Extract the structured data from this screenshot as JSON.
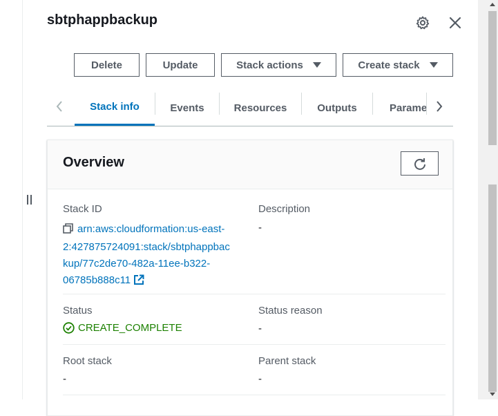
{
  "panel": {
    "title": "sbtphappbackup"
  },
  "actions": {
    "delete": "Delete",
    "update": "Update",
    "stack_actions": "Stack actions",
    "create_stack": "Create stack"
  },
  "tabs": [
    {
      "label": "Stack info",
      "active": true
    },
    {
      "label": "Events"
    },
    {
      "label": "Resources"
    },
    {
      "label": "Outputs"
    },
    {
      "label": "Parameters"
    }
  ],
  "overview": {
    "title": "Overview",
    "stack_id_label": "Stack ID",
    "stack_id_line1": "arn:aws:cloudformation:us-east-",
    "stack_id_line2": "2:427875724091:stack/sbtphappbac",
    "stack_id_line3": "kup/77c2de70-482a-11ee-b322-",
    "stack_id_line4": "06785b888c11",
    "description_label": "Description",
    "description_value": "-",
    "status_label": "Status",
    "status_value": "CREATE_COMPLETE",
    "status_reason_label": "Status reason",
    "status_reason_value": "-",
    "root_stack_label": "Root stack",
    "root_stack_value": "-",
    "parent_stack_label": "Parent stack",
    "parent_stack_value": "-"
  },
  "colors": {
    "link": "#0073bb",
    "success": "#1d8102",
    "text": "#16191f",
    "secondary": "#545b64"
  }
}
